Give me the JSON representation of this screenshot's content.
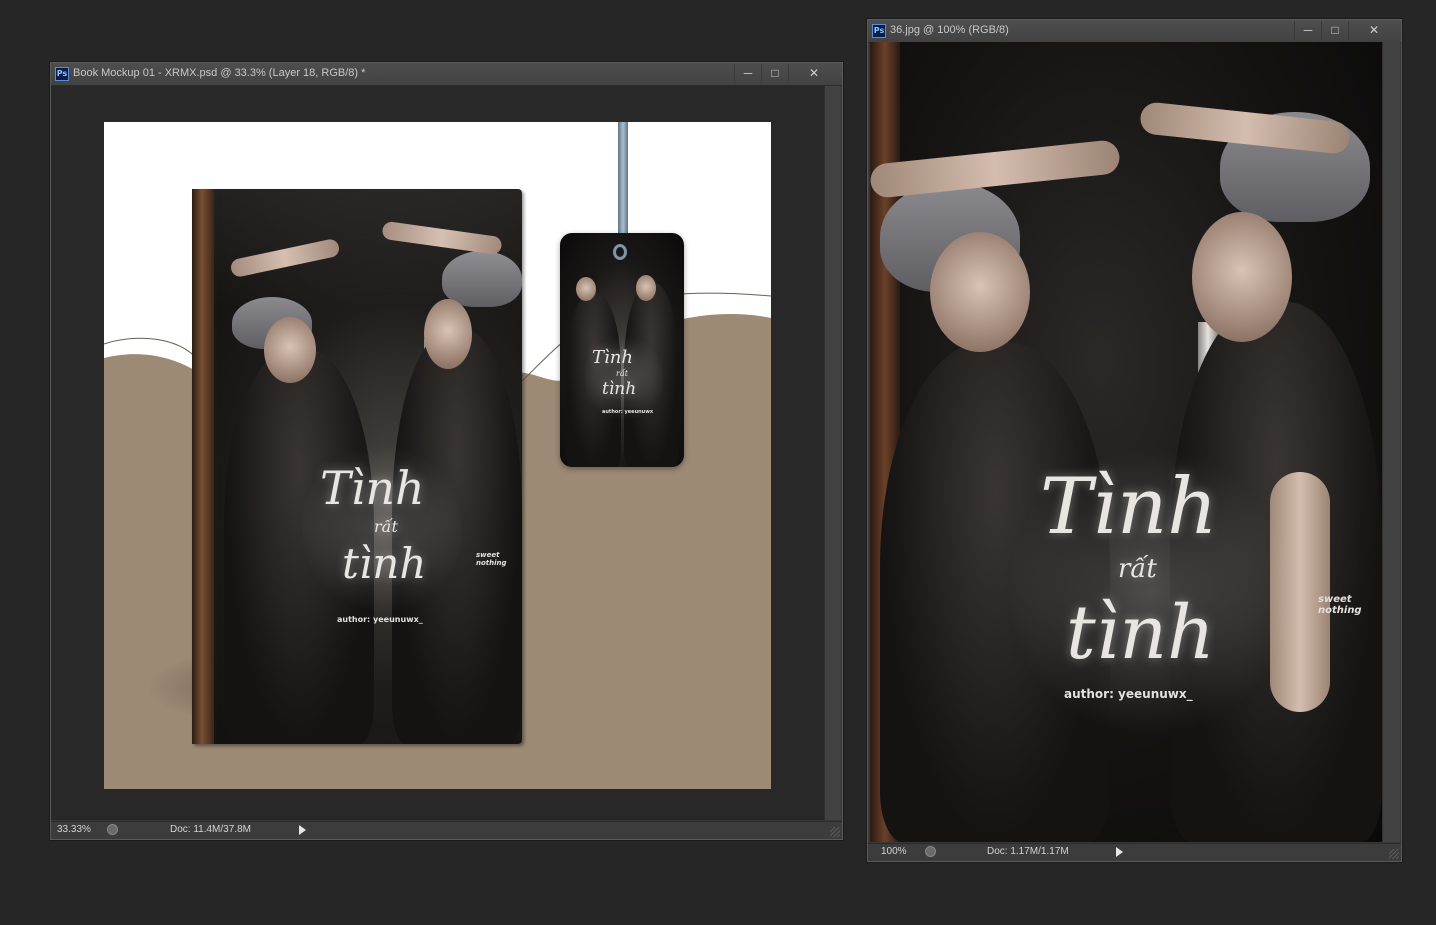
{
  "window1": {
    "app_icon": "Ps",
    "title": "Book Mockup 01 - XRMX.psd @ 33.3% (Layer 18, RGB/8) *",
    "minimize_icon": "minimize-icon",
    "maximize_icon": "maximize-icon",
    "close_icon": "close-icon",
    "status": {
      "zoom": "33.33%",
      "doc": "Doc: 11.4M/37.8M"
    },
    "canvas": {
      "background_color": "#ffffff",
      "wave_color": "#9c8a74",
      "book": {
        "title_line1": "Tình",
        "title_line2": "rất",
        "title_line3": "tình",
        "author": "author: yeeunuwx_",
        "sweet_text": "sweet nothing"
      },
      "bookmark": {
        "title_line1": "Tình",
        "title_line2": "rất",
        "title_line3": "tình",
        "author": "author: yeeunuwx"
      }
    }
  },
  "window2": {
    "app_icon": "Ps",
    "title": "36.jpg @ 100% (RGB/8)",
    "minimize_icon": "minimize-icon",
    "maximize_icon": "maximize-icon",
    "close_icon": "close-icon",
    "status": {
      "zoom": "100%",
      "doc": "Doc: 1.17M/1.17M"
    },
    "canvas": {
      "title_line1": "Tình",
      "title_line2": "rất",
      "title_line3": "tình",
      "author": "author: yeeunuwx_",
      "sweet_text": "sweet nothing"
    }
  },
  "colors": {
    "workspace": "#262626",
    "window_frame": "#383838",
    "titlebar": "#4a4a4a",
    "accent_tan": "#9c8a74"
  }
}
